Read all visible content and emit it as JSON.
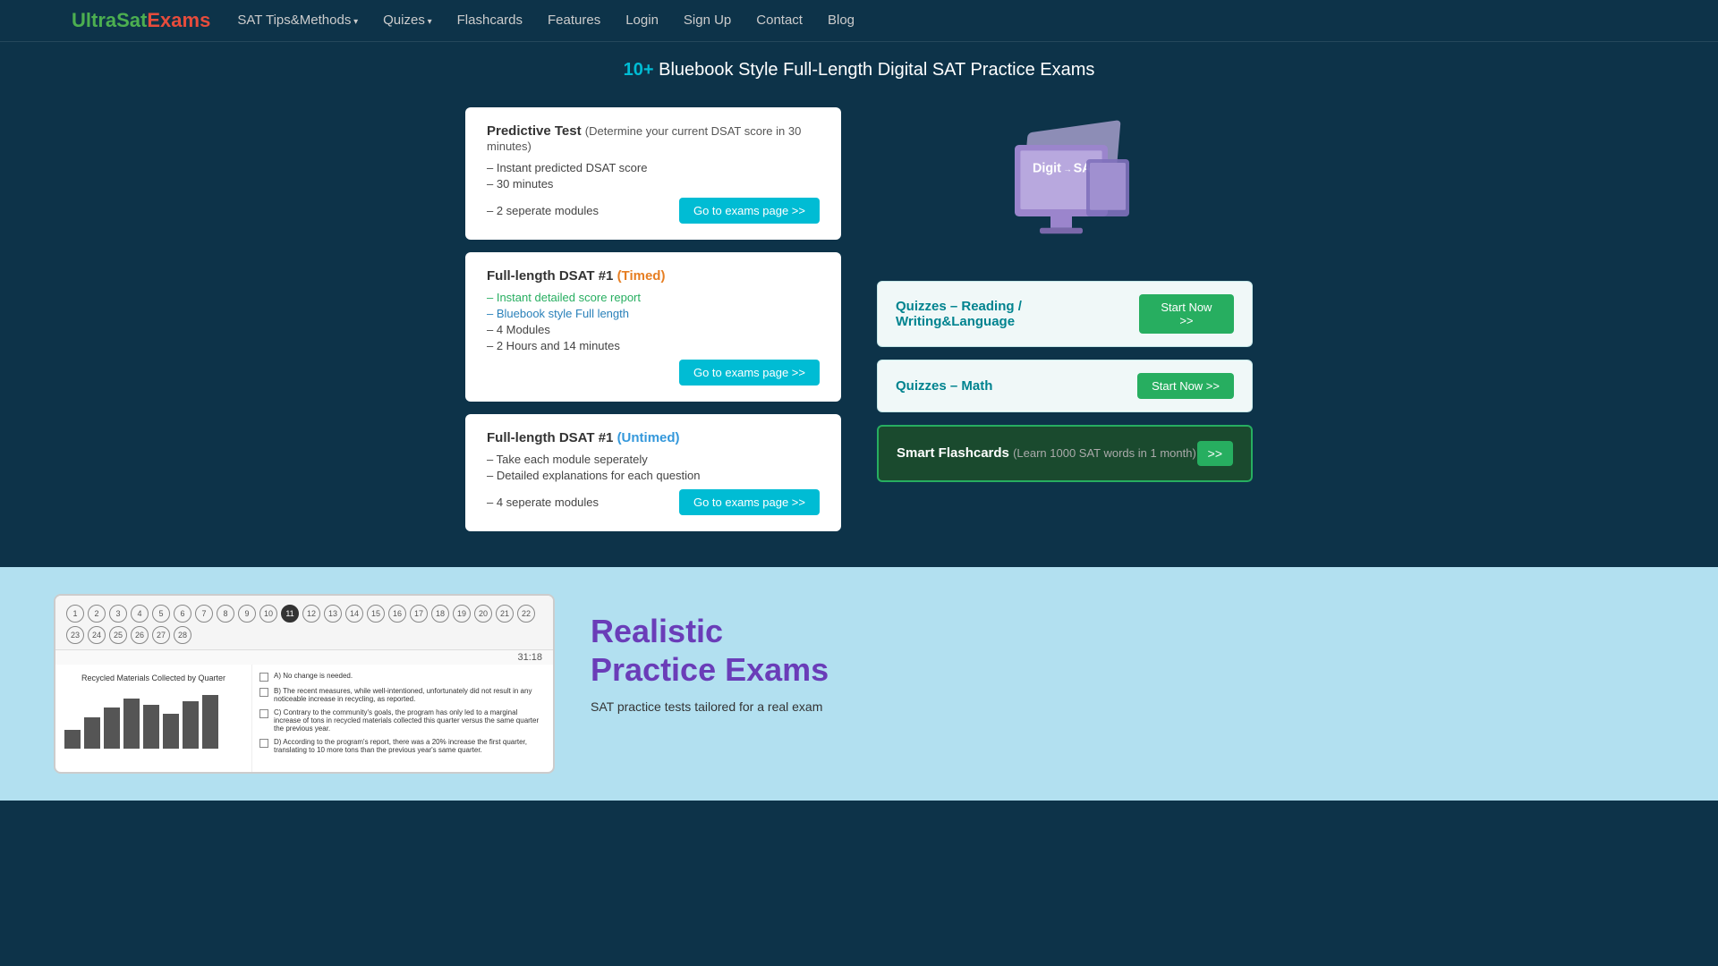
{
  "nav": {
    "logo": {
      "ultra": "UltraSat",
      "exams": "Exams"
    },
    "links": [
      {
        "label": "SAT Tips&Methods",
        "hasDropdown": true
      },
      {
        "label": "Quizes",
        "hasDropdown": true
      },
      {
        "label": "Flashcards",
        "hasDropdown": false
      },
      {
        "label": "Features",
        "hasDropdown": false
      },
      {
        "label": "Login",
        "hasDropdown": false
      },
      {
        "label": "Sign Up",
        "hasDropdown": false
      },
      {
        "label": "Contact",
        "hasDropdown": false
      },
      {
        "label": "Blog",
        "hasDropdown": false
      }
    ]
  },
  "hero": {
    "highlight": "10+",
    "title": " Bluebook Style Full-Length Digital SAT Practice Exams"
  },
  "cards": [
    {
      "id": "predictive",
      "title": "Predictive Test",
      "subtitle": "(Determine your current DSAT score in 30 minutes)",
      "items": [
        {
          "text": "– Instant predicted DSAT score",
          "class": ""
        },
        {
          "text": "– 30 minutes",
          "class": ""
        },
        {
          "text": "– 2 seperate modules",
          "class": ""
        }
      ],
      "button": "Go to exams page >>"
    },
    {
      "id": "full-timed",
      "title": "Full-length DSAT #1",
      "titleBadge": "(Timed)",
      "titleBadgeClass": "timed",
      "items": [
        {
          "text": "– Instant detailed score report",
          "class": "green-text"
        },
        {
          "text": "– Bluebook style Full length",
          "class": "blue-text"
        },
        {
          "text": "–  4 Modules",
          "class": ""
        },
        {
          "text": "–  2 Hours and 14 minutes",
          "class": ""
        }
      ],
      "button": "Go to exams page >>"
    },
    {
      "id": "full-untimed",
      "title": "Full-length DSAT #1",
      "titleBadge": "(Untimed)",
      "titleBadgeClass": "untimed",
      "items": [
        {
          "text": "– Take each module seperately",
          "class": ""
        },
        {
          "text": "– Detailed explanations for each question",
          "class": ""
        },
        {
          "text": "– 4 seperate modules",
          "class": ""
        }
      ],
      "button": "Go to exams page >>"
    }
  ],
  "quizCards": [
    {
      "id": "reading",
      "title": "Quizzes – Reading / Writing&Language",
      "button": "Start Now >>"
    },
    {
      "id": "math",
      "title": "Quizzes – Math",
      "button": "Start Now >>"
    }
  ],
  "flashcard": {
    "title": "Smart Flashcards",
    "subtitle": "(Learn 1000 SAT words in 1 month)",
    "button": ">>"
  },
  "lower": {
    "heading_line1": "Realistic",
    "heading_line2": "Practice Exams",
    "description": "SAT practice tests tailored for a real exam",
    "timer": "31:18",
    "chart": {
      "title": "Recycled Materials Collected by Quarter",
      "bars": [
        30,
        50,
        65,
        80,
        70,
        55,
        75,
        85
      ]
    },
    "numbers": [
      1,
      2,
      3,
      4,
      5,
      6,
      7,
      8,
      9,
      10,
      11,
      12,
      13,
      14,
      15,
      16,
      17,
      18,
      19,
      20,
      21,
      22,
      23,
      24,
      25,
      26,
      27,
      28
    ],
    "activeNumber": 11
  }
}
